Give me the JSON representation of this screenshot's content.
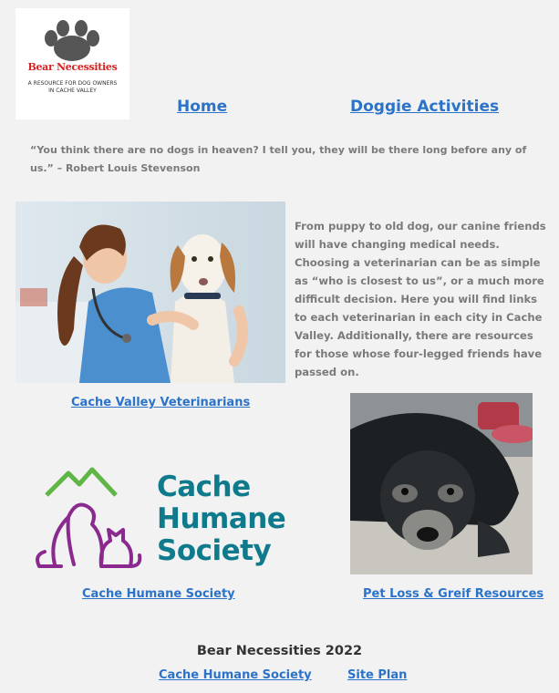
{
  "logo": {
    "title": "Bear Necessities",
    "tagline": "A Resource for Dog Owners in Cache Valley"
  },
  "nav": {
    "home": "Home",
    "doggie_activities": "Doggie Activities"
  },
  "quote": "“You think there are no dogs in heaven? I tell you, they will be there long before any of us.” – Robert Louis Stevenson",
  "intro": "From puppy to old dog, our canine friends will have changing medical needs. Choosing a veterinarian can be as simple as “who is closest to us”, or a much more difficult decision. Here you will find links to each veterinarian in each city in Cache Valley. Additionally, there are resources for those whose four-legged friends have passed on.",
  "links": {
    "veterinarians": "Cache Valley Veterinarians",
    "humane_society": "Cache Humane Society",
    "pet_loss": "Pet Loss & Greif Resources"
  },
  "humane_logo": {
    "line1": "Cache",
    "line2": "Humane",
    "line3": "Society"
  },
  "footer": {
    "title": "Bear Necessities 2022",
    "humane_society": "Cache Humane Society",
    "site_plan": "Site Plan"
  },
  "colors": {
    "link": "#2b73c9",
    "brand_teal": "#0e7a8c",
    "brand_purple": "#8a2a8f",
    "brand_green": "#5fb546",
    "logo_red": "#d72020"
  }
}
